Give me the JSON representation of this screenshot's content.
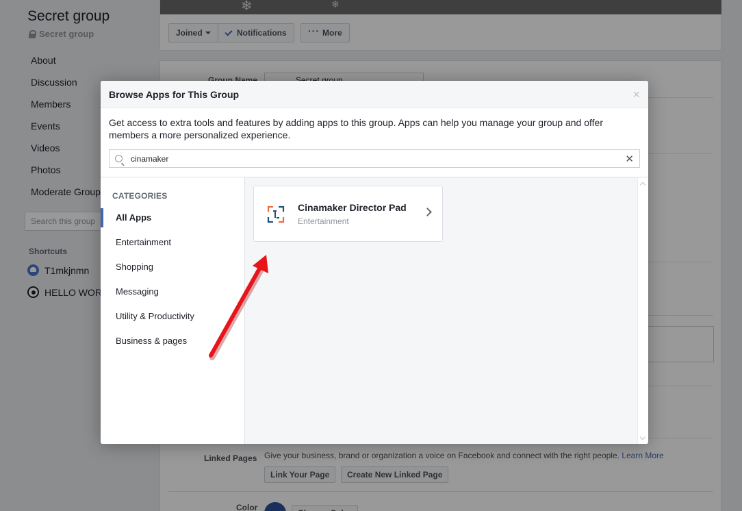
{
  "group": {
    "title": "Secret group",
    "privacy": "Secret group"
  },
  "nav": [
    "About",
    "Discussion",
    "Members",
    "Events",
    "Videos",
    "Photos",
    "Moderate Group"
  ],
  "search_group_placeholder": "Search this group",
  "shortcuts": {
    "title": "Shortcuts",
    "items": [
      "T1mkjnmn",
      "HELLO WORLD"
    ]
  },
  "cover_buttons": {
    "joined": "Joined",
    "notifications": "Notifications",
    "more": "More"
  },
  "settings": {
    "group_name_label": "Group Name",
    "group_name_value": "Secret group",
    "linked_pages_label": "Linked Pages",
    "linked_pages_text": "Give your business, brand or organization a voice on Facebook and connect with the right people.",
    "learn_more": "Learn More",
    "link_your_page": "Link Your Page",
    "create_linked_page": "Create New Linked Page",
    "color_label": "Color",
    "choose_color": "Choose Color"
  },
  "modal": {
    "title": "Browse Apps for This Group",
    "close": "×",
    "description": "Get access to extra tools and features by adding apps to this group. Apps can help you manage your group and offer members a more personalized experience.",
    "search_value": "cinamaker",
    "clear": "✕",
    "categories_title": "CATEGORIES",
    "categories": [
      "All Apps",
      "Entertainment",
      "Shopping",
      "Messaging",
      "Utility & Productivity",
      "Business & pages"
    ],
    "results": [
      {
        "name": "Cinamaker Director Pad",
        "category": "Entertainment"
      }
    ]
  },
  "colors": {
    "accent": "#4267b2",
    "annotation_arrow": "#e8141a",
    "app_icon_blue": "#1f4f7a",
    "app_icon_orange": "#f06a3c"
  }
}
